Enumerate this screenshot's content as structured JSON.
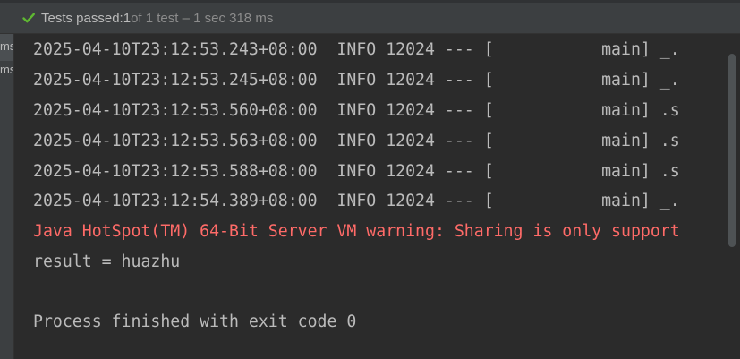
{
  "toolbar": {
    "check_icon": "check-icon",
    "passed_label": "Tests passed:",
    "passed_count": " 1",
    "passed_detail": " of 1 test – 1 sec 318 ms"
  },
  "test_tree": {
    "items": [
      "ms",
      "ms"
    ]
  },
  "console": {
    "lines": [
      {
        "text": "2025-04-10T23:12:53.243+08:00  INFO 12024 --- [           main] _.",
        "kind": "info"
      },
      {
        "text": "2025-04-10T23:12:53.245+08:00  INFO 12024 --- [           main] _.",
        "kind": "info"
      },
      {
        "text": "2025-04-10T23:12:53.560+08:00  INFO 12024 --- [           main] .s",
        "kind": "info"
      },
      {
        "text": "2025-04-10T23:12:53.563+08:00  INFO 12024 --- [           main] .s",
        "kind": "info"
      },
      {
        "text": "2025-04-10T23:12:53.588+08:00  INFO 12024 --- [           main] .s",
        "kind": "info"
      },
      {
        "text": "2025-04-10T23:12:54.389+08:00  INFO 12024 --- [           main] _.",
        "kind": "info"
      },
      {
        "text": "Java HotSpot(TM) 64-Bit Server VM warning: Sharing is only support",
        "kind": "error"
      },
      {
        "text": "result = huazhu",
        "kind": "info"
      },
      {
        "text": "",
        "kind": "info"
      },
      {
        "text": "Process finished with exit code 0",
        "kind": "info"
      }
    ]
  },
  "colors": {
    "background": "#2b2b2b",
    "toolbar": "#3c3f41",
    "text": "#bbbbbb",
    "error": "#ff6b68",
    "success": "#5fb832"
  }
}
